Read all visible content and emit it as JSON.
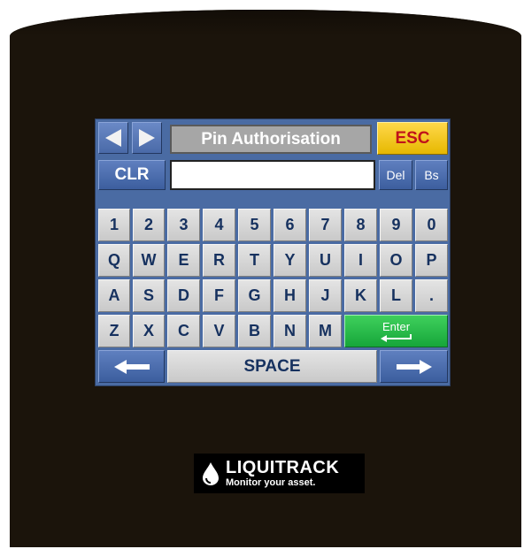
{
  "header": {
    "title": "Pin Authorisation",
    "esc_label": "ESC",
    "prev_icon": "triangle-left-icon",
    "next_icon": "triangle-right-icon"
  },
  "input_row": {
    "clr_label": "CLR",
    "value": "",
    "del_label": "Del",
    "bs_label": "Bs"
  },
  "keys": {
    "row1": [
      "1",
      "2",
      "3",
      "4",
      "5",
      "6",
      "7",
      "8",
      "9",
      "0"
    ],
    "row2": [
      "Q",
      "W",
      "E",
      "R",
      "T",
      "Y",
      "U",
      "I",
      "O",
      "P"
    ],
    "row3": [
      "A",
      "S",
      "D",
      "F",
      "G",
      "H",
      "J",
      "K",
      "L",
      "."
    ],
    "row4": [
      "Z",
      "X",
      "C",
      "V",
      "B",
      "N",
      "M"
    ]
  },
  "enter_label": "Enter",
  "space_label": "SPACE",
  "cursor_left_icon": "arrow-left-icon",
  "cursor_right_icon": "arrow-right-icon",
  "logo": {
    "name": "LIQUITRACK",
    "tagline": "Monitor your asset."
  },
  "colors": {
    "panel": "#4a6ba3",
    "key": "#d6d6d6",
    "esc": "#f2c81a",
    "enter": "#22b944",
    "device": "#1b140b"
  }
}
